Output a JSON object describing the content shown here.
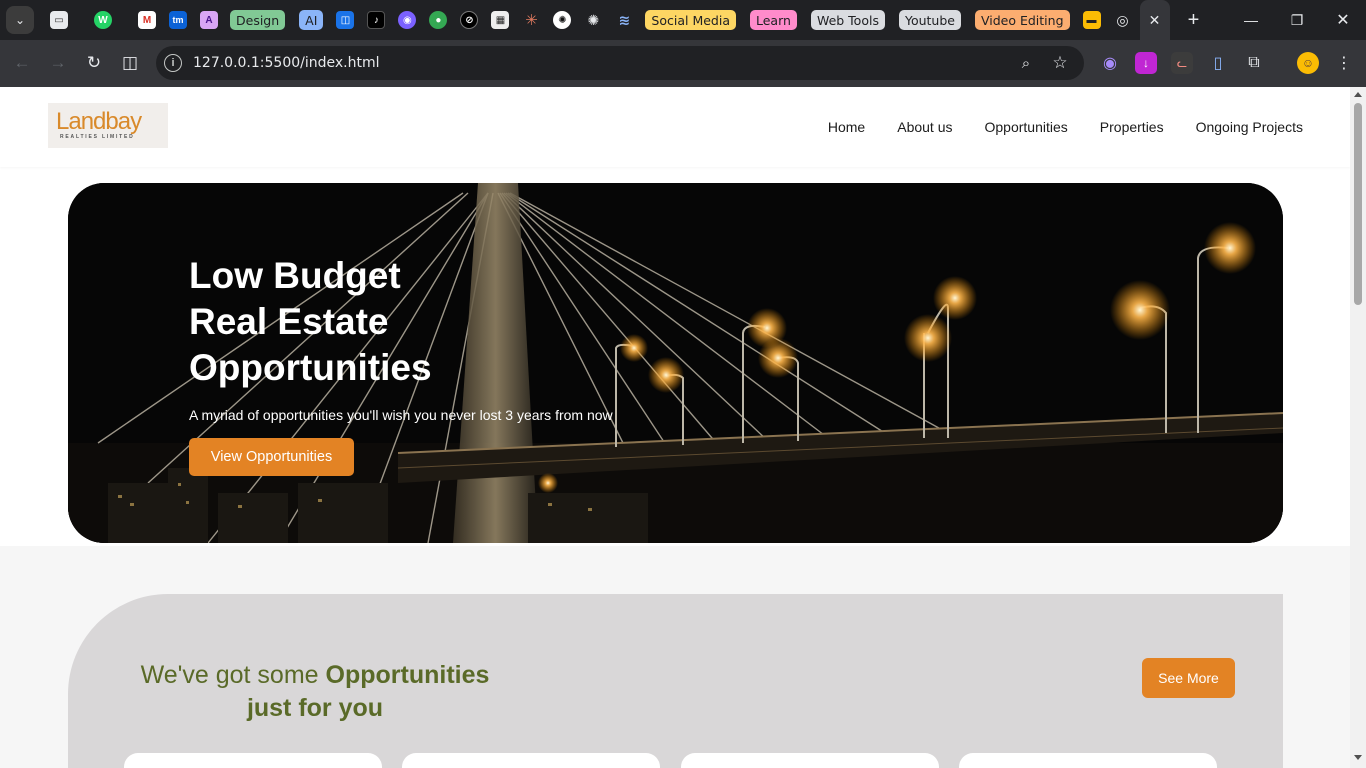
{
  "browser": {
    "bookmark_groups": [
      {
        "label": "Design",
        "color": "#81c995"
      },
      {
        "label": "AI",
        "color": "#8ab4f8"
      },
      {
        "label": "Social Media",
        "color": "#fdd663"
      },
      {
        "label": "Learn",
        "color": "#ff8bcb"
      },
      {
        "label": "Web Tools",
        "color": "#dadce0"
      },
      {
        "label": "Youtube",
        "color": "#dadce0"
      },
      {
        "label": "Video Editing",
        "color": "#fcad70"
      }
    ],
    "favicons": {
      "whatsapp": "W",
      "gmail": "M",
      "tm": "tm",
      "ai_app": "A",
      "tiktok": "♪",
      "claude": "✳"
    },
    "url": "127.0.0.1:5500/index.html"
  },
  "site": {
    "logo": {
      "word": "Landbay",
      "subtitle": "REALTIES LIMITED"
    },
    "nav": [
      "Home",
      "About us",
      "Opportunities",
      "Properties",
      "Ongoing Projects"
    ],
    "hero": {
      "title_lines": [
        "Low Budget",
        "Real Estate",
        "Opportunities"
      ],
      "subtitle": "A myriad of opportunities you'll wish you never lost 3 years from now",
      "cta": "View Opportunities"
    },
    "opportunities": {
      "heading_plain": "We've got some",
      "heading_bold": "Opportunities",
      "heading_line2": "just for you",
      "see_more": "See More"
    }
  }
}
